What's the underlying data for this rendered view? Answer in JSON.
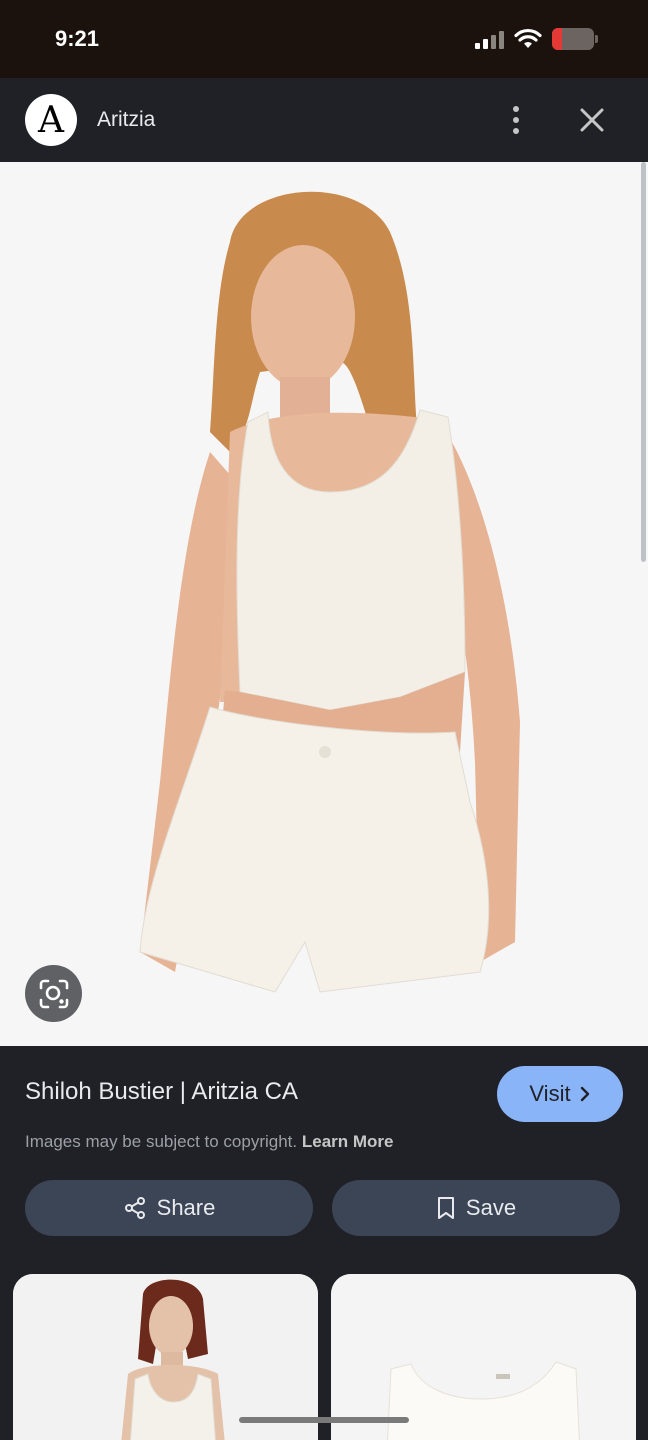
{
  "status_bar": {
    "time": "9:21"
  },
  "header": {
    "logo_letter": "A",
    "site_name": "Aritzia"
  },
  "result": {
    "title": "Shiloh Bustier | Aritzia CA",
    "visit_label": "Visit",
    "copyright_text": "Images may be subject to copyright.",
    "learn_more_label": "Learn More"
  },
  "actions": {
    "share_label": "Share",
    "save_label": "Save"
  },
  "colors": {
    "accent": "#8ab4f8",
    "background": "#1f2126",
    "pill": "#3c4556",
    "battery_low": "#e53935"
  }
}
